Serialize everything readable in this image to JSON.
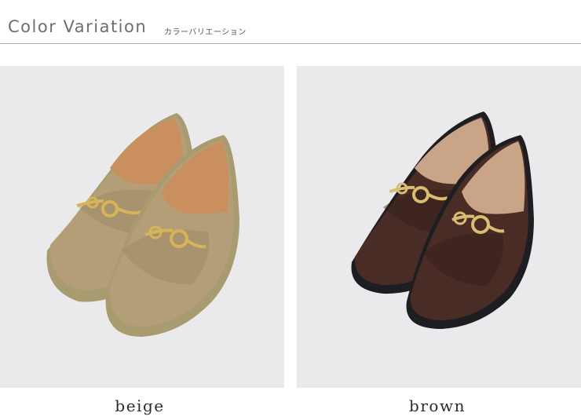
{
  "header": {
    "title": "Color Variation",
    "subtitle": "カラーバリエーション"
  },
  "variants": [
    {
      "label": "beige",
      "colors": {
        "upper": "#b39e78",
        "upper_shade": "#927d59",
        "sole": "#a99b70",
        "lining": "#c98f5e",
        "bit": "#d7b35a"
      }
    },
    {
      "label": "brown",
      "colors": {
        "upper": "#4a2c26",
        "upper_shade": "#321c18",
        "sole": "#1e1e22",
        "lining": "#caa487",
        "bit": "#d9bd72"
      }
    }
  ],
  "theme": {
    "photo_bg": "#eaeaec",
    "rule": "#a9a9a9",
    "title_color": "#6e6e6e"
  }
}
